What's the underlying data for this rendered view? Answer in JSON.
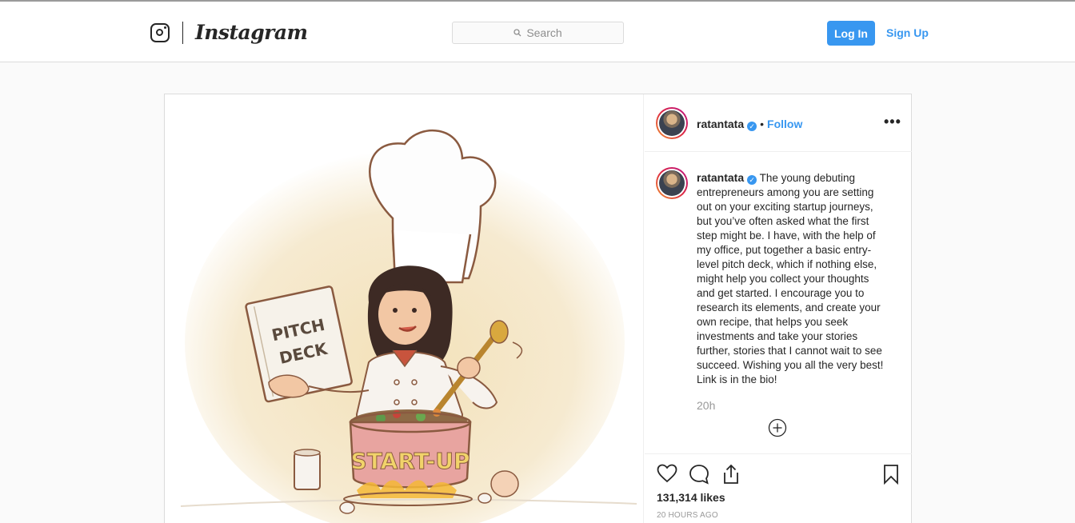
{
  "app": {
    "brand": "Instagram"
  },
  "search": {
    "placeholder": "Search"
  },
  "auth": {
    "login_label": "Log In",
    "signup_label": "Sign Up"
  },
  "post": {
    "author": "ratantata",
    "verified": true,
    "follow_label": "Follow",
    "separator": "•",
    "more_label": "•••",
    "caption_author": "ratantata",
    "caption_text": "The young debuting entrepreneurs among you are setting out on your exciting startup journeys, but you’ve often asked what the first step might be. I have, with the help of my office, put together a basic entry-level pitch deck, which if nothing else, might help you collect your thoughts and get started. I encourage you to research its elements, and create your own recipe, that helps you seek investments and take your stories further, stories that I cannot wait to see succeed. Wishing you all the very best! Link is in the bio!",
    "time_short": "20h",
    "likes": "131,314 likes",
    "time_long": "20 HOURS AGO",
    "image": {
      "menu_text_line1": "PITCH",
      "menu_text_line2": "DECK",
      "pot_text": "START-UP"
    }
  },
  "icons": {
    "logo": "instagram-glyph-icon",
    "search": "search-icon",
    "verified": "verified-badge-icon",
    "more": "more-options-icon",
    "load_more": "plus-circle-icon",
    "like": "heart-icon",
    "comment": "comment-icon",
    "share": "share-icon",
    "save": "bookmark-icon"
  },
  "colors": {
    "accent": "#3897f0",
    "text": "#262626",
    "muted": "#999999",
    "border": "#dbdbdb",
    "background": "#fafafa"
  }
}
